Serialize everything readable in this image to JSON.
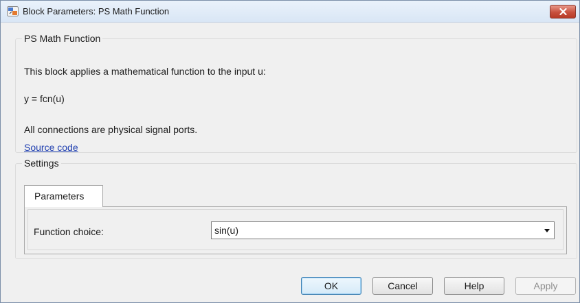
{
  "window": {
    "title": "Block Parameters: PS Math Function",
    "app_icon": "simulink-block-icon",
    "close_icon": "close-icon"
  },
  "description": {
    "group_title": "PS Math Function",
    "line1": "This block applies a mathematical function to the input u:",
    "line2": "y = fcn(u)",
    "line3": "All connections are physical signal ports.",
    "link": "Source code"
  },
  "settings": {
    "group_title": "Settings",
    "tabs": [
      {
        "label": "Parameters",
        "selected": true
      }
    ],
    "function_choice": {
      "label": "Function choice:",
      "value": "sin(u)"
    }
  },
  "buttons": {
    "ok": "OK",
    "cancel": "Cancel",
    "help": "Help",
    "apply": "Apply"
  },
  "colors": {
    "link": "#1f3fb0",
    "close_button": "#c8503d",
    "ok_border": "#3c7fb1"
  }
}
